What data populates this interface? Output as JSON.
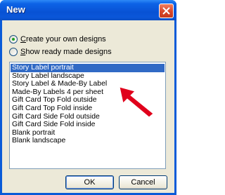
{
  "window": {
    "title": "New"
  },
  "options": {
    "create": {
      "prefix": "",
      "hotkey": "C",
      "rest": "reate your own designs",
      "checked": true
    },
    "show": {
      "prefix": "",
      "hotkey": "S",
      "rest": "how ready made designs",
      "checked": false
    }
  },
  "list": {
    "items": [
      "Story Label portrait",
      "Story Label landscape",
      "Story Label & Made-By Label",
      "Made-By Labels 4 per sheet",
      "Gift Card Top Fold outside",
      "Gift Card Top Fold inside",
      "Gift Card Side Fold outside",
      "Gift Card Side Fold inside",
      "Blank portrait",
      "Blank landscape"
    ],
    "selected_index": 0
  },
  "buttons": {
    "ok": "OK",
    "cancel": "Cancel"
  },
  "colors": {
    "selection": "#316ac5",
    "annotation_arrow": "#e0001b"
  }
}
